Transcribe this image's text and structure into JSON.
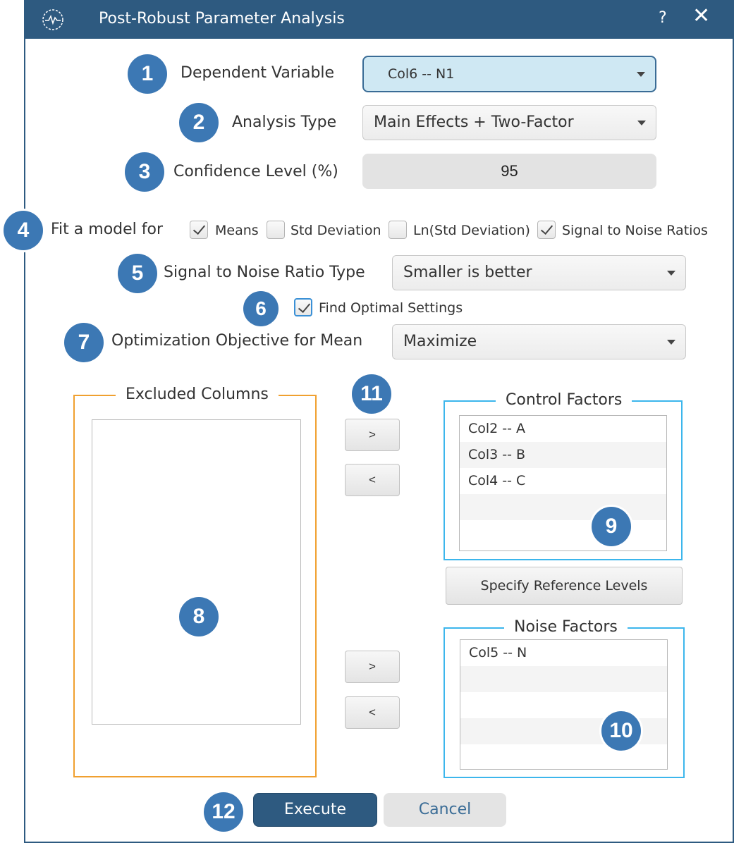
{
  "window": {
    "title": "Post-Robust Parameter Analysis",
    "help_label": "?",
    "close_label": "✕"
  },
  "form": {
    "dependent_variable": {
      "label": "Dependent Variable",
      "value": "Col6 -- N1",
      "badge": "1"
    },
    "analysis_type": {
      "label": "Analysis Type",
      "value": "Main Effects + Two-Factor",
      "badge": "2"
    },
    "confidence_level": {
      "label": "Confidence Level (%)",
      "value": "95",
      "badge": "3"
    },
    "fit_model": {
      "label": "Fit a model for",
      "badge": "4",
      "options": [
        {
          "label": "Means",
          "checked": true
        },
        {
          "label": "Std Deviation",
          "checked": false
        },
        {
          "label": "Ln(Std Deviation)",
          "checked": false
        },
        {
          "label": "Signal to Noise Ratios",
          "checked": true
        }
      ]
    },
    "sn_ratio_type": {
      "label": "Signal to Noise Ratio Type",
      "value": "Smaller is better",
      "badge": "5"
    },
    "find_optimal": {
      "label": "Find Optimal Settings",
      "checked": true,
      "badge": "6"
    },
    "optimization_objective": {
      "label": "Optimization Objective for Mean",
      "value": "Maximize",
      "badge": "7"
    }
  },
  "excluded_columns": {
    "title": "Excluded Columns",
    "items": [],
    "badge": "8"
  },
  "control_factors": {
    "title": "Control Factors",
    "items": [
      "Col2 -- A",
      "Col3 -- B",
      "Col4 -- C"
    ],
    "badge": "9"
  },
  "noise_factors": {
    "title": "Noise Factors",
    "items": [
      "Col5 -- N"
    ],
    "badge": "10"
  },
  "move_buttons": {
    "add_label": ">",
    "remove_label": "<",
    "badge": "11"
  },
  "specify_reference_levels_label": "Specify Reference Levels",
  "footer": {
    "execute_label": "Execute",
    "cancel_label": "Cancel",
    "badge": "12"
  },
  "colors": {
    "titlebar": "#2e5a80",
    "badge": "#3c78b4",
    "excluded_border": "#f0a030",
    "factor_border": "#3cb6ec",
    "active_combo": "#cfe8f3"
  }
}
